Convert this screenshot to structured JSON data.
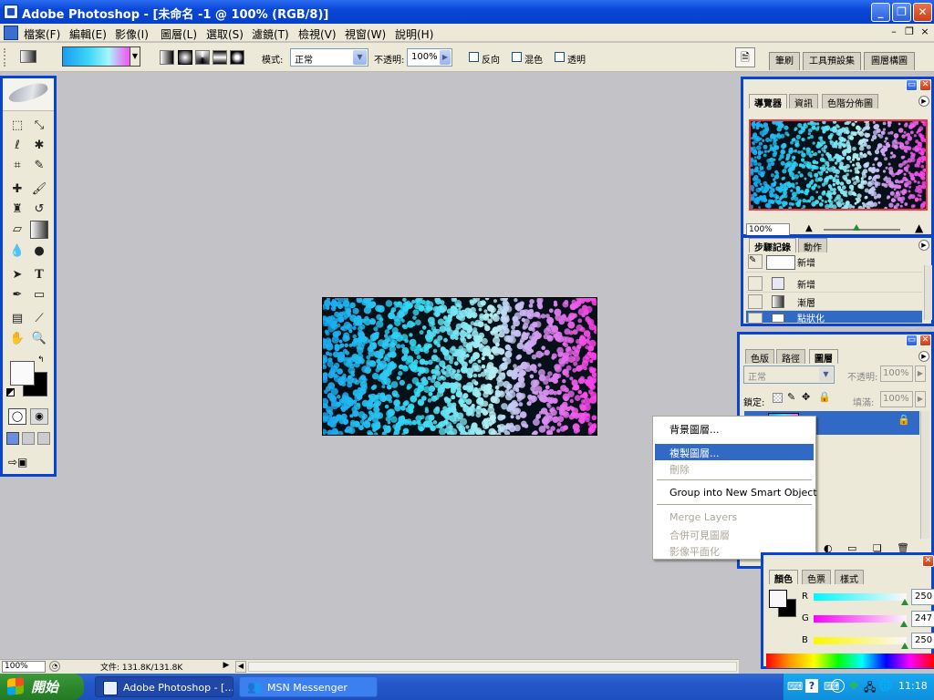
{
  "window": {
    "title": "Adobe Photoshop - [未命名 -1 @ 100% (RGB/8)]",
    "controls": [
      "_",
      "❐",
      "✕"
    ]
  },
  "menu": {
    "items": [
      "檔案(F)",
      "編輯(E)",
      "影像(I)",
      "圖層(L)",
      "選取(S)",
      "濾鏡(T)",
      "檢視(V)",
      "視窗(W)",
      "說明(H)"
    ],
    "doc_controls": [
      "–",
      "❐",
      "×"
    ]
  },
  "options": {
    "mode_label": "模式:",
    "mode_value": "正常",
    "opacity_label": "不透明:",
    "opacity_value": "100%",
    "reverse_label": "反向",
    "dither_label": "混色",
    "transparency_label": "透明",
    "well_tabs": [
      "筆刷",
      "工具預設集",
      "圖層構圖"
    ]
  },
  "navigator": {
    "tabs": [
      "導覽器",
      "資訊",
      "色階分佈圖"
    ],
    "zoom": "100%"
  },
  "history": {
    "tabs": [
      "步驟記錄",
      "動作"
    ],
    "snapshot_label": "新增",
    "steps": [
      "新增",
      "漸層",
      "點狀化"
    ]
  },
  "layers": {
    "tabs": [
      "色版",
      "路徑",
      "圖層"
    ],
    "blend_mode": "正常",
    "opacity_label": "不透明:",
    "opacity_value": "100%",
    "lock_label": "鎖定:",
    "fill_label": "填滿:",
    "fill_value": "100%"
  },
  "context_menu": {
    "items": [
      {
        "label": "背景圖層...",
        "state": "enabled"
      },
      {
        "label": "複製圖層...",
        "state": "highlighted"
      },
      {
        "label": "刪除",
        "state": "disabled"
      },
      {
        "label": "Group into New Smart Object",
        "state": "enabled"
      },
      {
        "label": "Merge Layers",
        "state": "disabled"
      },
      {
        "label": "合併可見圖層",
        "state": "disabled"
      },
      {
        "label": "影像平面化",
        "state": "disabled"
      }
    ]
  },
  "color_panel": {
    "tabs": [
      "顏色",
      "色票",
      "樣式"
    ],
    "channels": [
      {
        "label": "R",
        "value": "250",
        "level": 0.98
      },
      {
        "label": "G",
        "value": "247",
        "level": 0.969
      },
      {
        "label": "B",
        "value": "250",
        "level": 0.98
      }
    ]
  },
  "status": {
    "zoom": "100%",
    "doc_size": "文件: 131.8K/131.8K"
  },
  "taskbar": {
    "start_label": "開始",
    "tasks": [
      "Adobe Photoshop - [...",
      "MSN Messenger"
    ],
    "clock": "11:18"
  },
  "colors": {
    "xp_blue": "#0843d2",
    "highlight": "#316ac5",
    "workspace": "#c3c2c6",
    "start_green": "#2d8a2d"
  },
  "icons": {
    "tools": [
      "marquee-icon",
      "move-icon",
      "lasso-icon",
      "magic-wand-icon",
      "crop-icon",
      "slice-icon",
      "healing-brush-icon",
      "brush-icon",
      "clone-stamp-icon",
      "history-brush-icon",
      "eraser-icon",
      "gradient-icon",
      "blur-icon",
      "dodge-icon",
      "path-select-icon",
      "type-icon",
      "pen-icon",
      "shape-icon",
      "notes-icon",
      "eyedropper-icon",
      "hand-icon",
      "zoom-icon"
    ]
  }
}
